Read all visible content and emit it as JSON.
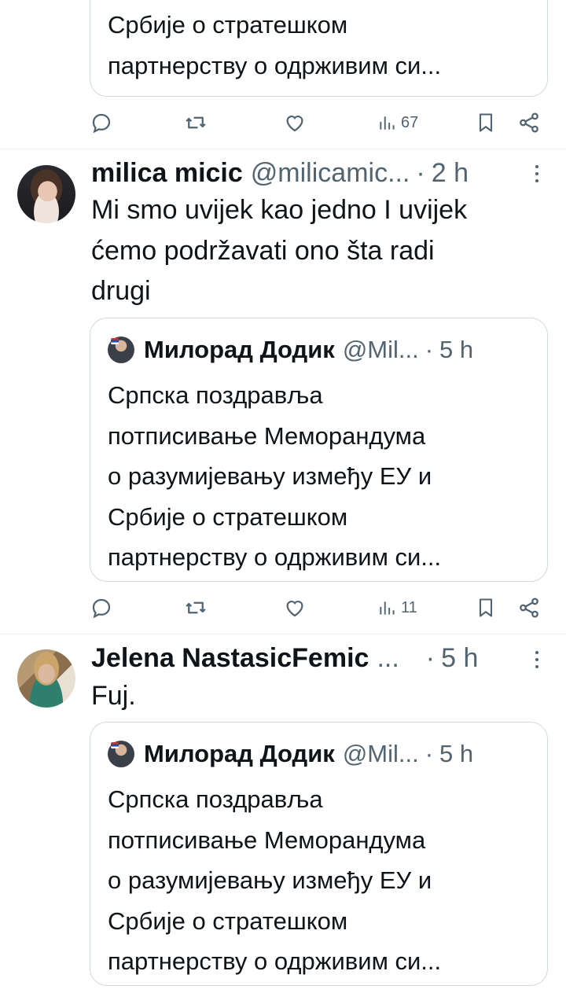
{
  "quoted_tweet": {
    "author_name": "Милорад Додик",
    "author_handle": "@Mil...",
    "time": "5 h",
    "text_lines": [
      "Српска поздравља",
      "потписивање Меморандума",
      "о разумијевању између ЕУ и",
      "Србије о стратешком",
      "партнерству о одрживим си..."
    ]
  },
  "top_partial": {
    "quote_lines": [
      "Србије о стратешком",
      "партнерству о одрживим си..."
    ],
    "views": "67"
  },
  "tweets": [
    {
      "author_name": "milica micic",
      "author_handle": "@milicamic...",
      "time": "2 h",
      "text_lines": [
        "Mi smo uvijek kao jedno I uvijek",
        "ćemo podržavati ono šta radi",
        "drugi"
      ],
      "views": "11"
    },
    {
      "author_name": "Jelena NastasicFemic",
      "author_handle": "...",
      "time": "5 h",
      "text_lines": [
        "Fuj."
      ]
    }
  ],
  "separator_dot": "·",
  "icons": [
    "reply-icon",
    "retweet-icon",
    "like-icon",
    "views-icon",
    "bookmark-icon",
    "share-icon",
    "more-icon"
  ],
  "colors": {
    "text": "#0f1419",
    "secondary": "#536471",
    "border": "#cfd9de"
  }
}
